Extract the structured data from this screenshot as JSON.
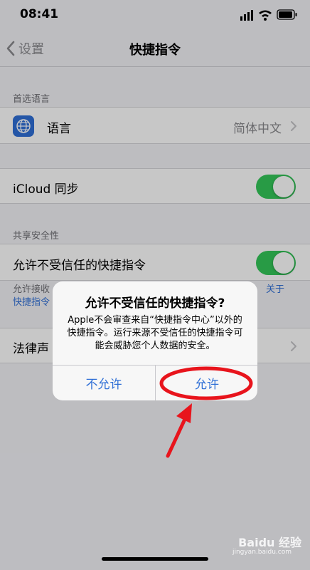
{
  "status_bar": {
    "time": "08:41"
  },
  "nav": {
    "back_label": "设置",
    "title": "快捷指令"
  },
  "section_language": {
    "header": "首选语言",
    "label": "语言",
    "value": "简体中文"
  },
  "icloud": {
    "label": "iCloud 同步",
    "enabled": true
  },
  "section_sharing": {
    "header": "共享安全性",
    "allow_untrusted_label": "允许不受信任的快捷指令",
    "allow_untrusted_enabled": true,
    "footer_text": "允许接收",
    "footer_link_right": "关于",
    "footer_link_left": "快捷指令"
  },
  "legal": {
    "label": "法律声"
  },
  "alert": {
    "title": "允许不受信任的快捷指令?",
    "message": "Apple不会审查来自“快捷指令中心”以外的快捷指令。运行来源不受信任的快捷指令可能会威胁您个人数据的安全。",
    "deny_label": "不允许",
    "allow_label": "允许"
  },
  "watermark": {
    "text": "Baidu 经验",
    "url": "jingyan.baidu.com"
  },
  "colors": {
    "accent": "#2f6fd6",
    "toggle_on": "#34c759",
    "annotation": "#e8141c"
  }
}
